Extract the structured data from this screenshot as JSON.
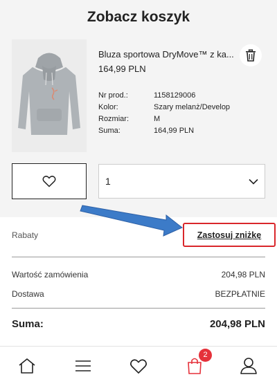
{
  "page": {
    "title": "Zobacz koszyk"
  },
  "product": {
    "name": "Bluza sportowa DryMove™ z ka...",
    "price": "164,99 PLN",
    "details": [
      {
        "label": "Nr prod.:",
        "value": "1158129006"
      },
      {
        "label": "Kolor:",
        "value": "Szary melanż/Develop"
      },
      {
        "label": "Rozmiar:",
        "value": "M"
      },
      {
        "label": "Suma:",
        "value": "164,99 PLN"
      }
    ],
    "quantity": "1"
  },
  "discount": {
    "label": "Rabaty",
    "apply_label": "Zastosuj zniżkę"
  },
  "summary": {
    "order_value_label": "Wartość zamówienia",
    "order_value": "204,98 PLN",
    "shipping_label": "Dostawa",
    "shipping_value": "BEZPŁATNIE",
    "total_label": "Suma:",
    "total_value": "204,98 PLN"
  },
  "nav": {
    "cart_count": "2"
  },
  "colors": {
    "accent_red": "#d9262a",
    "badge_red": "#e5313a",
    "arrow_blue": "#3c7bc8"
  },
  "icons": [
    "trash-icon",
    "heart-icon",
    "chevron-down-icon",
    "home-icon",
    "menu-icon",
    "heart-icon",
    "shopping-bag-icon",
    "user-icon",
    "arrow-annotation"
  ]
}
